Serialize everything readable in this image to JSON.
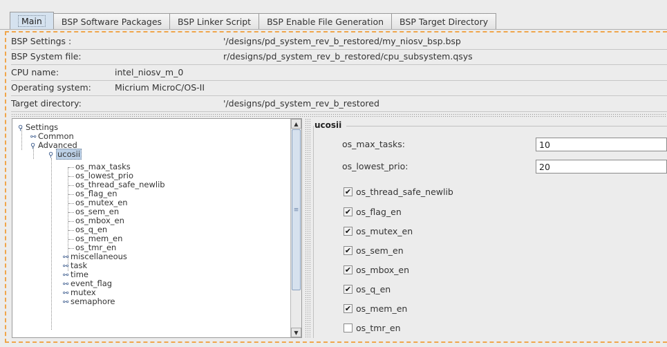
{
  "tabs": [
    {
      "label": "Main",
      "active": true
    },
    {
      "label": "BSP Software Packages",
      "active": false
    },
    {
      "label": "BSP Linker Script",
      "active": false
    },
    {
      "label": "BSP Enable File Generation",
      "active": false
    },
    {
      "label": "BSP Target Directory",
      "active": false
    }
  ],
  "info": {
    "bsp_settings_label": "BSP Settings :",
    "bsp_settings_value": "'/designs/pd_system_rev_b_restored/my_niosv_bsp.bsp",
    "bsp_system_file_label": "BSP System file:",
    "bsp_system_file_value": "r/designs/pd_system_rev_b_restored/cpu_subsystem.qsys",
    "cpu_name_label": "CPU name:",
    "cpu_name_value": "intel_niosv_m_0",
    "os_label": "Operating system:",
    "os_value": "Micrium MicroC/OS-II",
    "target_dir_label": "Target directory:",
    "target_dir_value": "'/designs/pd_system_rev_b_restored"
  },
  "tree": {
    "settings": "Settings",
    "common": "Common",
    "advanced": "Advanced",
    "ucosii": "ucosii",
    "leaves": [
      "os_max_tasks",
      "os_lowest_prio",
      "os_thread_safe_newlib",
      "os_flag_en",
      "os_mutex_en",
      "os_sem_en",
      "os_mbox_en",
      "os_q_en",
      "os_mem_en",
      "os_tmr_en"
    ],
    "groups": [
      "miscellaneous",
      "task",
      "time",
      "event_flag",
      "mutex",
      "semaphore"
    ]
  },
  "panel": {
    "group_title": "ucosii",
    "max_tasks_label": "os_max_tasks:",
    "max_tasks_value": "10",
    "lowest_prio_label": "os_lowest_prio:",
    "lowest_prio_value": "20",
    "checkboxes": [
      {
        "label": "os_thread_safe_newlib",
        "checked": true
      },
      {
        "label": "os_flag_en",
        "checked": true
      },
      {
        "label": "os_mutex_en",
        "checked": true
      },
      {
        "label": "os_sem_en",
        "checked": true
      },
      {
        "label": "os_mbox_en",
        "checked": true
      },
      {
        "label": "os_q_en",
        "checked": true
      },
      {
        "label": "os_mem_en",
        "checked": true
      },
      {
        "label": "os_tmr_en",
        "checked": false
      }
    ]
  },
  "icons": {
    "expanded": "expanded-node-icon",
    "collapsed": "collapsed-node-icon",
    "check": "checkmark-icon"
  }
}
